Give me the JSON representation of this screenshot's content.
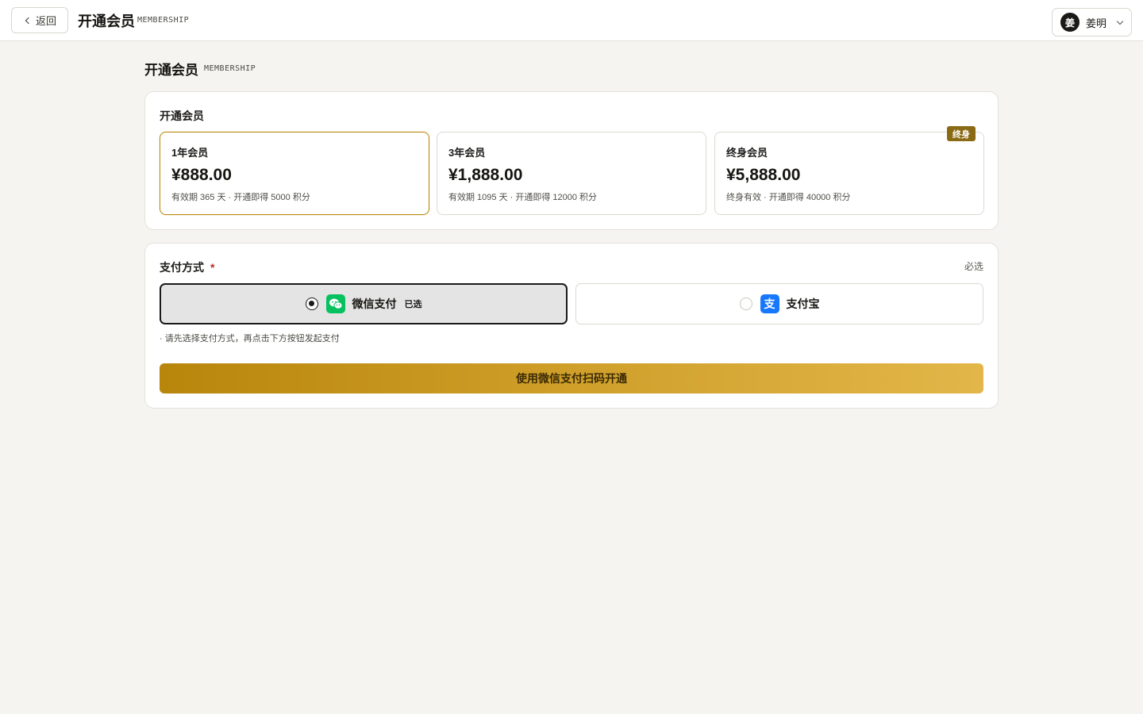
{
  "header": {
    "back_label": "返回",
    "title": "开通会员",
    "subtitle": "MEMBERSHIP",
    "user": {
      "avatar_initial": "姜",
      "name": "姜明"
    }
  },
  "page": {
    "title": "开通会员",
    "subtitle": "MEMBERSHIP"
  },
  "plans_section": {
    "label": "开通会员",
    "plans": [
      {
        "name": "1年会员",
        "price": "¥888.00",
        "desc": "有效期 365 天 · 开通即得 5000 积分",
        "selected": true
      },
      {
        "name": "3年会员",
        "price": "¥1,888.00",
        "desc": "有效期 1095 天 · 开通即得 12000 积分",
        "selected": false
      },
      {
        "name": "终身会员",
        "price": "¥5,888.00",
        "desc": "终身有效 · 开通即得 40000 积分",
        "badge": "终身",
        "selected": false
      }
    ]
  },
  "payment_section": {
    "label": "支付方式",
    "required_star": "*",
    "required_tag": "必选",
    "options": [
      {
        "label": "微信支付",
        "icon": "wechat-icon",
        "selected": true,
        "selected_tag": "已选"
      },
      {
        "label": "支付宝",
        "icon": "alipay-icon",
        "icon_glyph": "支",
        "selected": false
      }
    ],
    "hint": "· 请先选择支付方式，再点击下方按钮发起支付",
    "submit_label": "使用微信支付扫码开通"
  },
  "colors": {
    "page_bg": "#f5f4f0",
    "accent_gold": "#b8860b",
    "badge_bg": "#8a6a14",
    "wechat_green": "#07c160",
    "alipay_blue": "#1677ff",
    "required_red": "#b8302a"
  }
}
